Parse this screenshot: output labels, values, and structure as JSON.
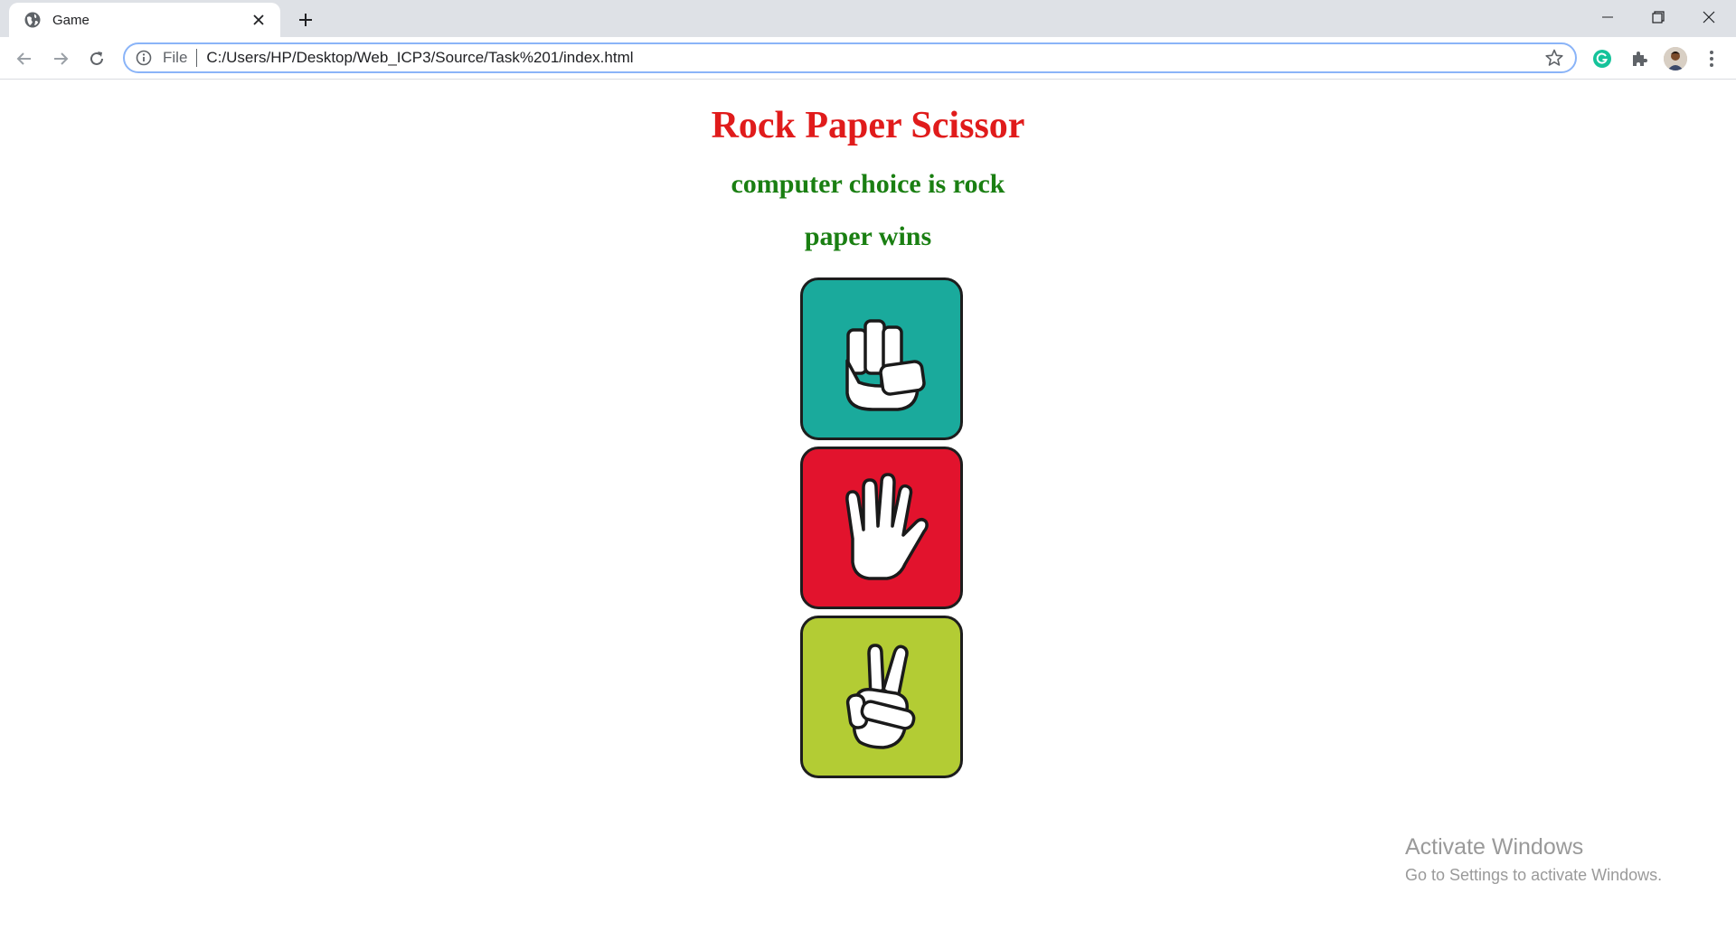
{
  "browser": {
    "tab_title": "Game",
    "url_scheme": "File",
    "url": "C:/Users/HP/Desktop/Web_ICP3/Source/Task%201/index.html"
  },
  "game": {
    "title": "Rock Paper Scissor",
    "computer_choice": "computer choice is rock",
    "result": "paper wins",
    "choices": [
      {
        "name": "rock",
        "icon": "fist-icon",
        "color": "#1aaa9c"
      },
      {
        "name": "paper",
        "icon": "open-hand-icon",
        "color": "#e2132d"
      },
      {
        "name": "scissors",
        "icon": "peace-hand-icon",
        "color": "#b3cc34"
      }
    ]
  },
  "watermark": {
    "title": "Activate Windows",
    "subtitle": "Go to Settings to activate Windows."
  },
  "colors": {
    "title": "#e01b1b",
    "message": "#1a7f12"
  }
}
